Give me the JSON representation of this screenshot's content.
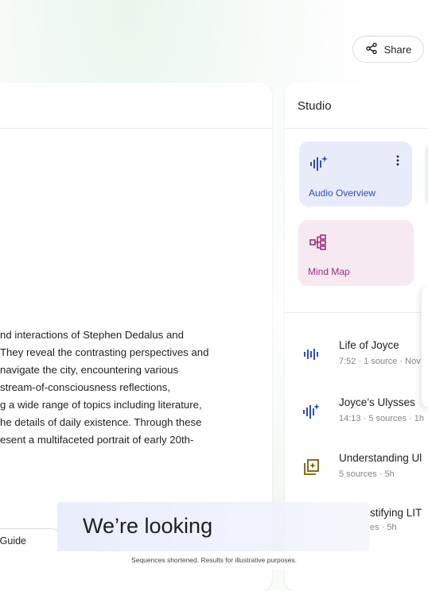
{
  "header": {
    "share_label": "Share"
  },
  "chat": {
    "summary_lines": [
      "nd interactions of Stephen Dedalus and",
      "They reveal the contrasting perspectives and",
      " navigate the city, encountering various",
      "stream-of-consciousness reflections,",
      "g a wide range of topics including literature,",
      "he details of daily existence. Through these",
      "esent a multifaceted portrait of early 20th-"
    ],
    "guide_chip_label": "Guide"
  },
  "studio": {
    "title": "Studio",
    "cards": {
      "audio_overview": "Audio Overview",
      "mind_map": "Mind Map"
    },
    "items": [
      {
        "title": "Life of Joyce",
        "subtitle": "7:52 · 1 source · Nov",
        "icon": "waveform-icon"
      },
      {
        "title": "Joyce’s Ulysses",
        "subtitle": "14:13 · 5 sources · 1h",
        "icon": "sparkle-waveform-icon"
      },
      {
        "title": "Understanding Ul",
        "subtitle": "5 sources · 5h",
        "icon": "study-guide-icon"
      },
      {
        "title": "stifying LIT",
        "subtitle": "es · 5h",
        "icon": "document-icon"
      }
    ]
  },
  "overlay": {
    "caption": "We’re looking",
    "disclaimer": "Sequences shortened. Results for illustrative purposes."
  },
  "colors": {
    "audio_card_bg": "#e8ecfa",
    "audio_accent": "#2f4fb4",
    "mind_card_bg": "#f7e9f2",
    "mind_accent": "#9c2f7e",
    "study_accent": "#7a5c00"
  }
}
